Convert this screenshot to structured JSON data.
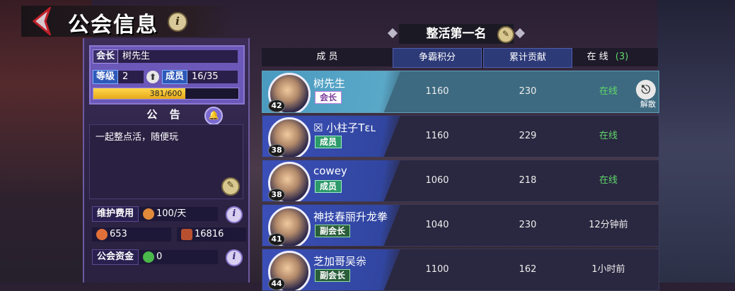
{
  "header": {
    "title": "公会信息",
    "info_icon": "i"
  },
  "guild": {
    "leader_tag": "会长",
    "leader_name": "树先生",
    "level_tag": "等级",
    "level": "2",
    "members_tag": "成员",
    "members": "16/35",
    "exp_text": "381/600",
    "exp_fraction": 0.635
  },
  "notice": {
    "title": "公 告",
    "text": "一起整点活，随便玩"
  },
  "stats": {
    "upkeep_label": "维护费用",
    "upkeep_value": "100/天",
    "currency1": "653",
    "currency2": "16816",
    "fund_label": "公会资金",
    "fund_value": "0"
  },
  "guild_name": "整活第一名",
  "table": {
    "col_member": "成 员",
    "col_score": "争霸积分",
    "col_contrib": "累计贡献",
    "col_online_label": "在 线",
    "col_online_count": "(3)"
  },
  "members": [
    {
      "level": "42",
      "name": "树先生",
      "role": "会长",
      "role_type": "leader",
      "score": "1160",
      "contrib": "230",
      "status": "在线",
      "online": true,
      "self": true
    },
    {
      "level": "38",
      "name": "☒ 小柱子Tɛʟ",
      "role": "成员",
      "role_type": "member",
      "score": "1160",
      "contrib": "229",
      "status": "在线",
      "online": true,
      "self": false
    },
    {
      "level": "38",
      "name": "cowey",
      "role": "成员",
      "role_type": "member",
      "score": "1060",
      "contrib": "218",
      "status": "在线",
      "online": true,
      "self": false
    },
    {
      "level": "41",
      "name": "神技春丽升龙拳",
      "role": "副会长",
      "role_type": "vice",
      "score": "1040",
      "contrib": "230",
      "status": "12分钟前",
      "online": false,
      "self": false
    },
    {
      "level": "44",
      "name": "芝加哥吴尜",
      "role": "副会长",
      "role_type": "vice",
      "score": "1100",
      "contrib": "162",
      "status": "1小时前",
      "online": false,
      "self": false
    }
  ],
  "kick_label": "解散",
  "colors": {
    "accent": "#6b58b8",
    "online": "#5fd86a",
    "exp": "#ffd84a"
  }
}
